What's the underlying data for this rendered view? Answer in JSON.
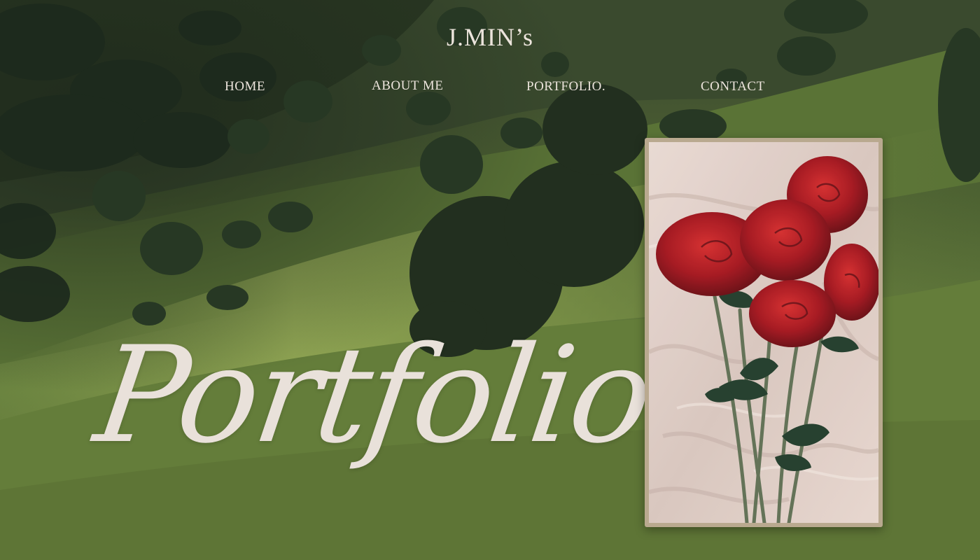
{
  "site": {
    "title": "J.MIN’s"
  },
  "nav": {
    "items": [
      {
        "label": "HOME"
      },
      {
        "label": "ABOUT ME"
      },
      {
        "label": "PORTFOLIO."
      },
      {
        "label": "CONTACT"
      }
    ]
  },
  "hero": {
    "title": "Portfolio.",
    "background": "grassy-hills-photo",
    "image": "red-roses-photo"
  },
  "colors": {
    "text": "#ece4dc",
    "frame": "#b9a98f",
    "grass": "#6f8a3e",
    "rose": "#a3121b"
  }
}
